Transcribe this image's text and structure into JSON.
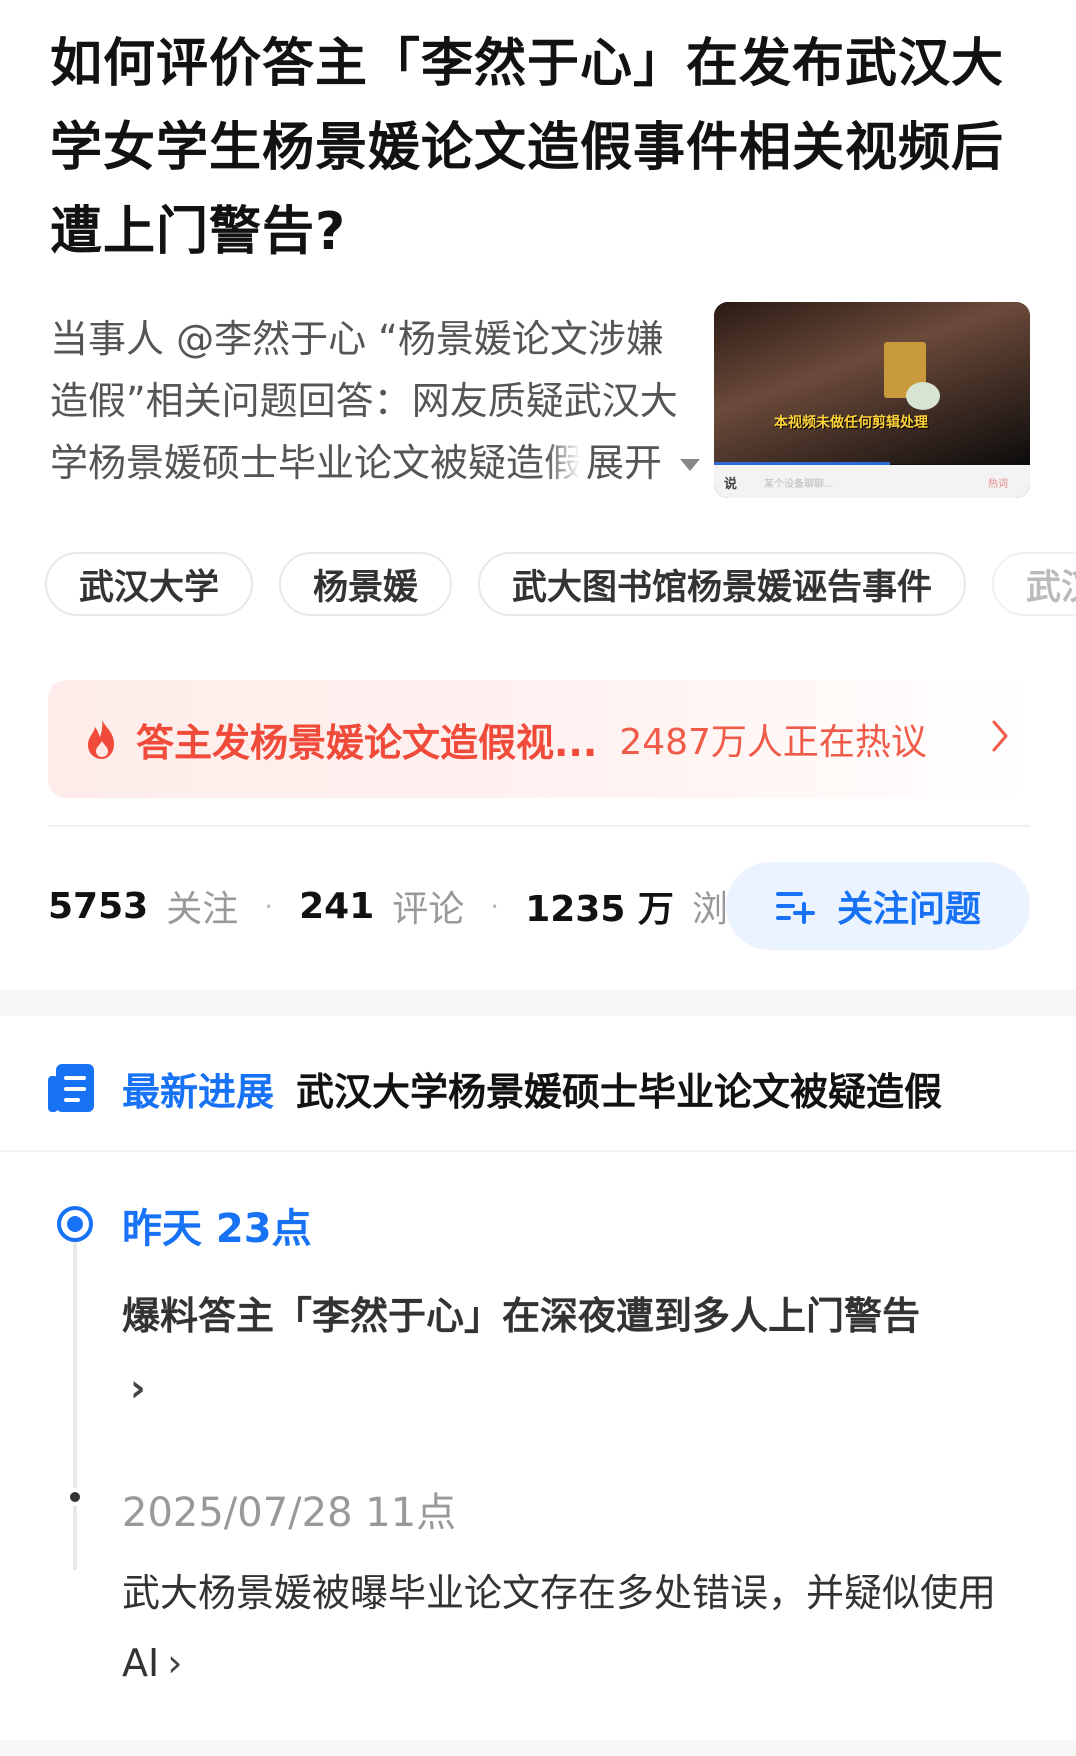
{
  "question": {
    "title": "如何评价答主「李然于心」在发布武汉大学女学生杨景媛论文造假事件相关视频后遭上门警告?",
    "excerpt": "当事人 @李然于心 “杨景媛论文涉嫌造假”相关问题回答：网友质疑武汉大学杨景媛硕士毕业论文被疑造假",
    "expand_label": "展开"
  },
  "thumbnail": {
    "caption": "本视频未做任何剪辑处理",
    "bar_logo": "说",
    "bar_middle": "某个设备聊聊...",
    "bar_right": "热词"
  },
  "tags": [
    "武汉大学",
    "杨景媛",
    "武大图书馆杨景媛诬告事件",
    "武汉"
  ],
  "hot": {
    "title": "答主发杨景媛论文造假视...",
    "count_text": "2487万人正在热议",
    "accent_color": "#f04b3a"
  },
  "stats": {
    "follow_count": "5753",
    "follow_label": "关注",
    "comment_count": "241",
    "comment_label": "评论",
    "view_count": "1235 万",
    "view_label": "浏览"
  },
  "follow_button": {
    "label": "关注问题",
    "color": "#1772f6"
  },
  "progress": {
    "label": "最新进展",
    "headline": "武汉大学杨景媛硕士毕业论文被疑造假"
  },
  "timeline": [
    {
      "time": "昨天  23点",
      "text": "爆料答主「李然于心」在深夜遭到多人上门警告",
      "arrow": "›"
    },
    {
      "time": "2025/07/28  11点",
      "text": "武大杨景媛被曝毕业论文存在多处错误，并疑似使用 AI",
      "arrow": "›"
    }
  ]
}
